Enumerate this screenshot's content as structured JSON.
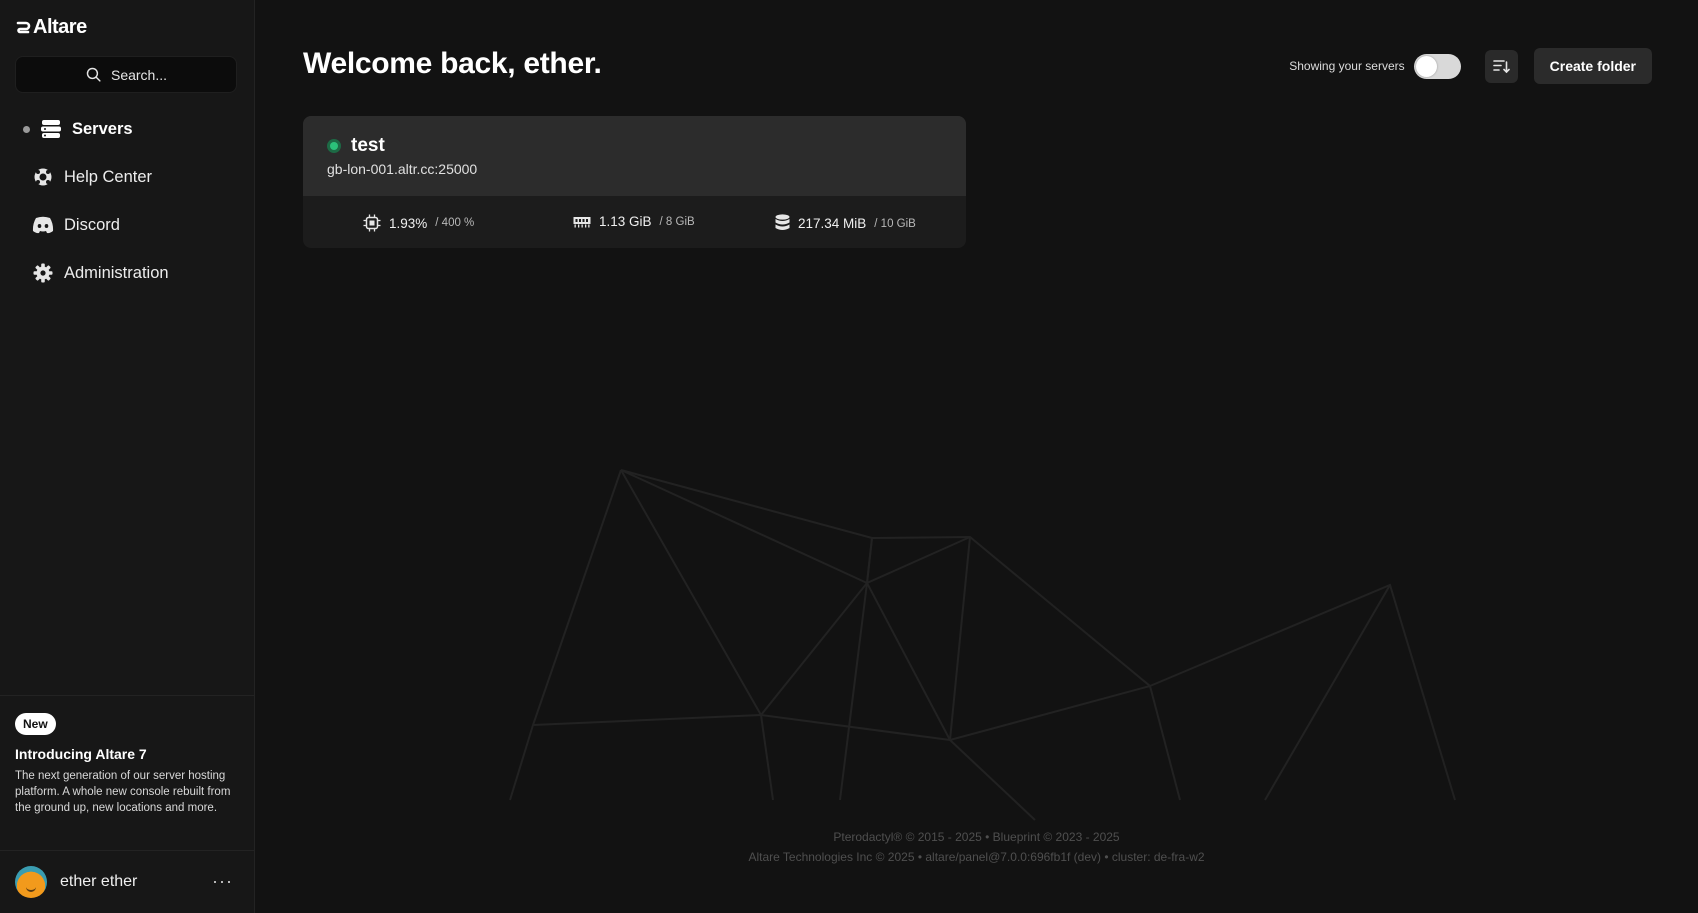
{
  "sidebar": {
    "brand": "Altare",
    "search_placeholder": "Search...",
    "items": [
      {
        "label": "Servers",
        "icon": "server-icon",
        "active": true
      },
      {
        "label": "Help Center",
        "icon": "lifebuoy-icon",
        "active": false
      },
      {
        "label": "Discord",
        "icon": "discord-icon",
        "active": false
      },
      {
        "label": "Administration",
        "icon": "gear-icon",
        "active": false
      }
    ],
    "promo": {
      "badge": "New",
      "title": "Introducing Altare 7",
      "text": "The next generation of our server hosting platform. A whole new console rebuilt from the ground up, new locations and more."
    },
    "user": {
      "name": "ether ether",
      "more": "···"
    }
  },
  "main": {
    "title": "Welcome back, ether.",
    "toggle_label": "Showing your servers",
    "toggle_on": false,
    "create_folder": "Create folder",
    "servers": [
      {
        "name": "test",
        "address": "gb-lon-001.altr.cc:25000",
        "status": "online",
        "cpu": {
          "value": "1.93%",
          "limit": "/ 400 %"
        },
        "memory": {
          "value": "1.13 GiB",
          "limit": "/ 8 GiB"
        },
        "disk": {
          "value": "217.34 MiB",
          "limit": "/ 10 GiB"
        }
      }
    ],
    "footer": {
      "line1": "Pterodactyl® © 2015 - 2025  •  Blueprint © 2023 - 2025",
      "line2": "Altare Technologies Inc © 2025  •  altare/panel@7.0.0:696fb1f (dev)  •  cluster: de-fra-w2"
    }
  },
  "colors": {
    "status_online": "#2bc27a",
    "background": "#121212",
    "sidebar": "#171717"
  }
}
